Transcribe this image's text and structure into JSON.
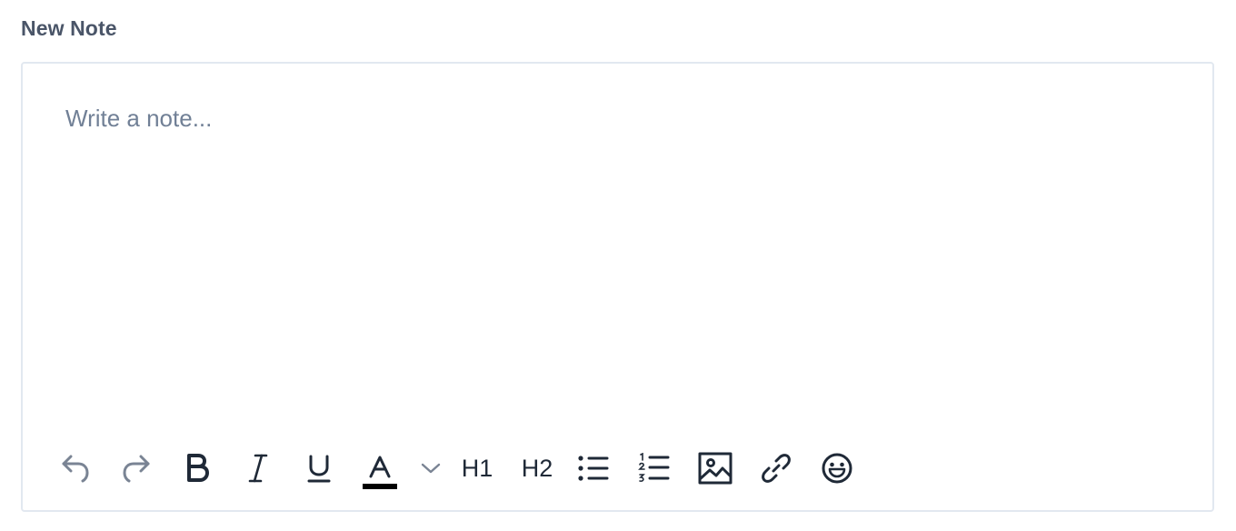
{
  "note": {
    "title": "New Note",
    "placeholder": "Write a note..."
  },
  "toolbar": {
    "h1_label": "H1",
    "h2_label": "H2",
    "text_color": "#000000",
    "buttons": [
      "undo-icon",
      "redo-icon",
      "bold-icon",
      "italic-icon",
      "underline-icon",
      "text-color-icon",
      "chevron-down-icon",
      "heading-1",
      "heading-2",
      "bullet-list-icon",
      "numbered-list-icon",
      "image-icon",
      "link-icon",
      "emoji-icon"
    ]
  }
}
